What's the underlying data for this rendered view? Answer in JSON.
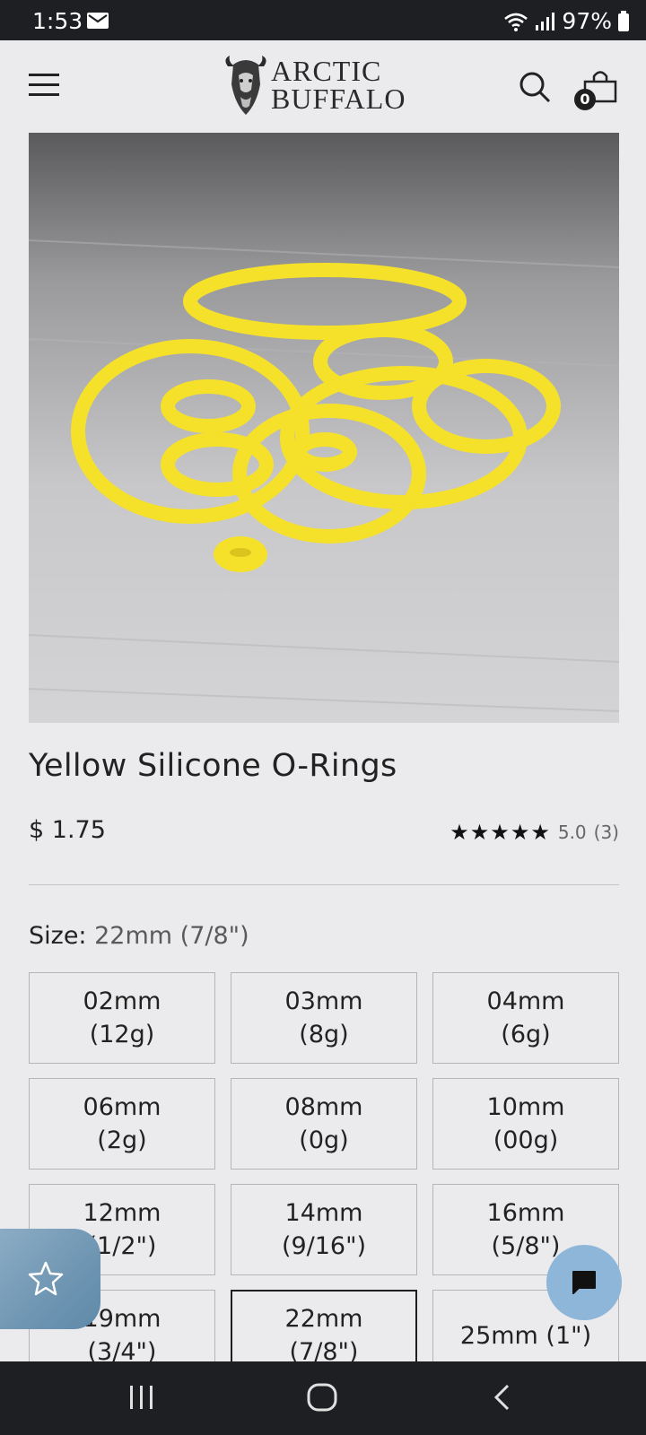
{
  "status_bar": {
    "time": "1:53",
    "battery": "97%"
  },
  "header": {
    "brand_line1": "ARCTIC",
    "brand_line2": "BUFFALO",
    "cart_count": "0"
  },
  "product": {
    "title": "Yellow Silicone O-Rings",
    "price": "$ 1.75",
    "stars": "★★★★★",
    "rating": "5.0",
    "review_count": "(3)",
    "image_icon": "yellow-o-rings-photo"
  },
  "size": {
    "label": "Size:",
    "selected": "22mm (7/8\")",
    "options": [
      {
        "line1": "02mm",
        "line2": "(12g)"
      },
      {
        "line1": "03mm",
        "line2": "(8g)"
      },
      {
        "line1": "04mm",
        "line2": "(6g)"
      },
      {
        "line1": "06mm",
        "line2": "(2g)"
      },
      {
        "line1": "08mm",
        "line2": "(0g)"
      },
      {
        "line1": "10mm",
        "line2": "(00g)"
      },
      {
        "line1": "12mm",
        "line2": "(1/2\")"
      },
      {
        "line1": "14mm",
        "line2": "(9/16\")"
      },
      {
        "line1": "16mm",
        "line2": "(5/8\")"
      },
      {
        "line1": "19mm",
        "line2": "(3/4\")"
      },
      {
        "line1": "22mm",
        "line2": "(7/8\")"
      },
      {
        "line1": "25mm (1\")",
        "line2": ""
      }
    ]
  },
  "colors": {
    "accent": "#1f1f1f",
    "ring_yellow": "#f5e12a",
    "chat": "#8eb6d9"
  }
}
